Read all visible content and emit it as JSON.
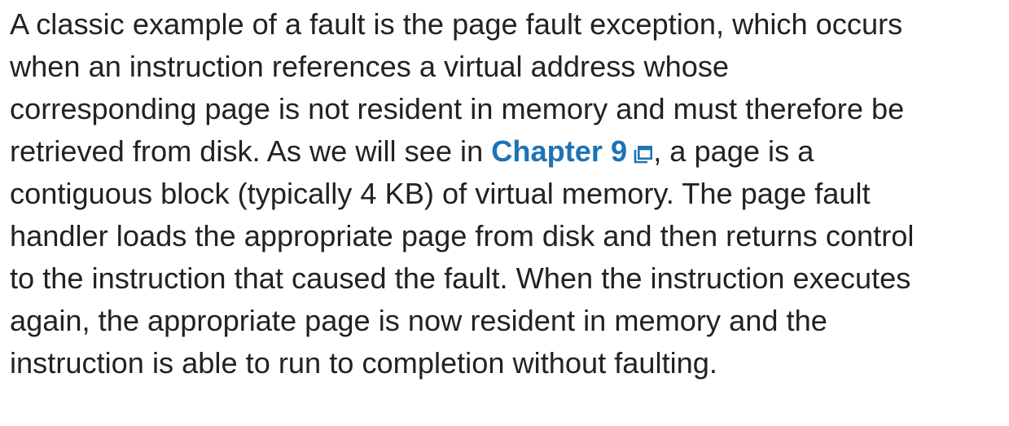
{
  "colors": {
    "text": "#222222",
    "link": "#1d73b5",
    "background": "#ffffff"
  },
  "paragraph": {
    "line1": "A classic example of a fault is the page fault exception, which occurs",
    "line2": "when an instruction references a virtual address whose",
    "line3": "corresponding page is not resident in memory and must therefore be",
    "line4_before": "retrieved from disk. As we will see in ",
    "link_text": "Chapter 9",
    "link_icon": "popup-window-icon",
    "line4_after": ", a page is a",
    "line5": "contiguous block (typically 4 KB) of virtual memory. The page fault",
    "line6": "handler loads the appropriate page from disk and then returns control",
    "line7": "to the instruction that caused the fault. When the instruction executes",
    "line8": "again, the appropriate page is now resident in memory and the",
    "line9": "instruction is able to run to completion without faulting."
  }
}
